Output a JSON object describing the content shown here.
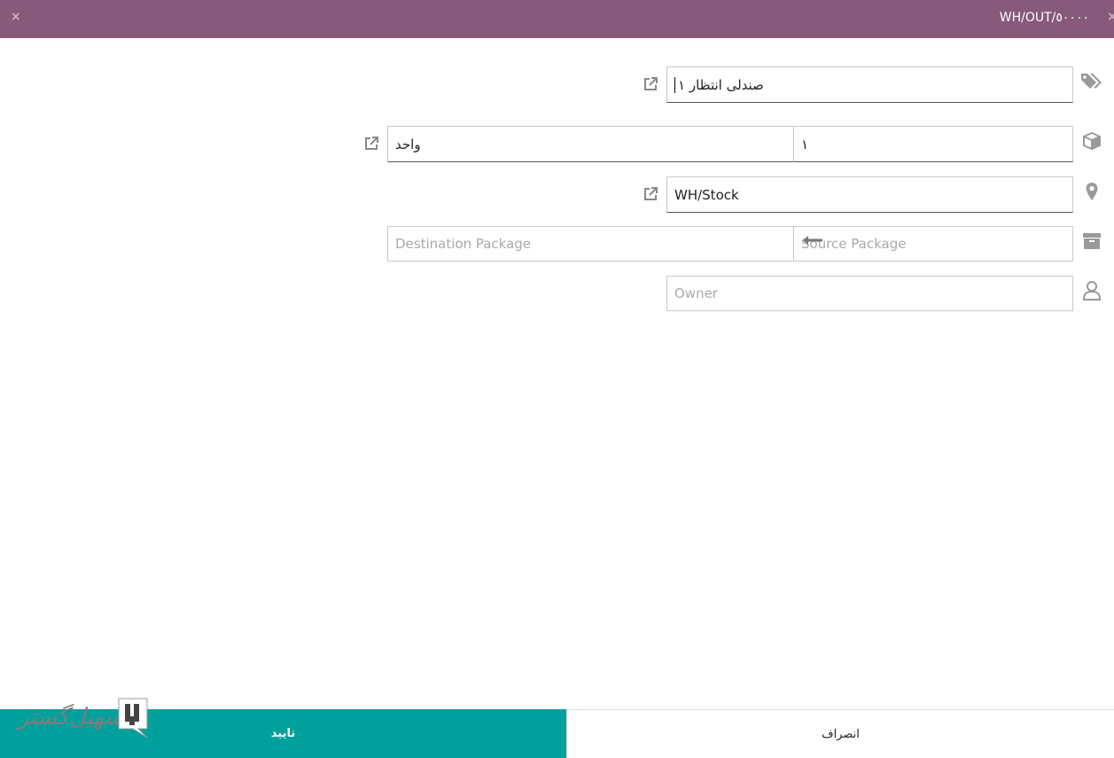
{
  "header": {
    "title": "WH/OUT/٥٠٠٠٠",
    "close_left": "×",
    "close_right": "×"
  },
  "form": {
    "product": {
      "value": "صندلی انتظار ۱",
      "icon": "tags-icon"
    },
    "quantity": {
      "value": "۱",
      "icon": "cube-icon"
    },
    "uom": {
      "value": "واحد"
    },
    "location": {
      "value": "WH/Stock",
      "icon": "map-marker-icon"
    },
    "source_package": {
      "placeholder": "Source Package",
      "icon": "archive-box-icon"
    },
    "destination_package": {
      "placeholder": "Destination Package"
    },
    "owner": {
      "placeholder": "Owner",
      "icon": "user-icon"
    }
  },
  "footer": {
    "confirm_label": "تایید",
    "cancel_label": "انصراف"
  },
  "watermark": {
    "text": "تسهیل‌گستر"
  },
  "colors": {
    "header_bg": "#875A7B",
    "confirm_bg": "#00A09D",
    "icon_gray": "#9a9a9a"
  }
}
